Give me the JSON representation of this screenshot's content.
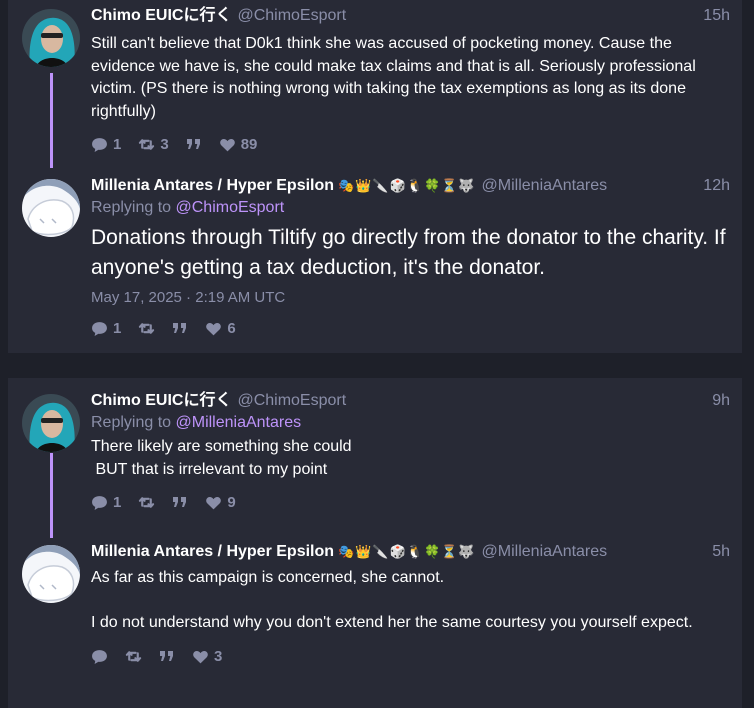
{
  "colors": {
    "background": "#1e2029",
    "card": "#282a36",
    "accent": "#bd93f9",
    "muted": "#8a8ea8",
    "text": "#ffffff"
  },
  "icons": {
    "reply": "speech-bubble-icon",
    "retweet": "retweet-icon",
    "quote": "quote-icon",
    "like": "heart-icon"
  },
  "thread1": {
    "tweet1": {
      "name": "Chimo EUICに行く",
      "handle": "@ChimoEsport",
      "time": "15h",
      "text": "Still can't believe that D0k1 think she was accused of pocketing money. Cause the evidence we have is, she could make tax claims and that is all.  Seriously professional victim. (PS there is nothing wrong with taking the tax exemptions as long as its done rightfully)",
      "replies": "1",
      "retweets": "3",
      "quotes": "",
      "likes": "89"
    },
    "tweet2": {
      "name": "Millenia Antares / Hyper Epsilon",
      "emojis": "🎭👑🔪🎲🐧🍀⏳🐺",
      "handle": "@MilleniaAntares",
      "time": "12h",
      "replying_prefix": "Replying to",
      "replying_to": "@ChimoEsport",
      "text": "Donations through Tiltify go directly from the donator to the charity. If anyone's getting a tax deduction, it's the donator.",
      "date": "May 17, 2025 · 2:19 AM UTC",
      "replies": "1",
      "retweets": "",
      "quotes": "",
      "likes": "6"
    }
  },
  "thread2": {
    "tweet1": {
      "name": "Chimo EUICに行く",
      "handle": "@ChimoEsport",
      "time": "9h",
      "replying_prefix": "Replying to",
      "replying_to": "@MilleniaAntares",
      "text_line1": "There likely are something she could",
      "text_line2": " BUT that is irrelevant to my point",
      "replies": "1",
      "retweets": "",
      "quotes": "",
      "likes": "9"
    },
    "tweet2": {
      "name": "Millenia Antares / Hyper Epsilon",
      "emojis": "🎭👑🔪🎲🐧🍀⏳🐺",
      "handle": "@MilleniaAntares",
      "time": "5h",
      "text_p1": "As far as this campaign is concerned, she cannot.",
      "text_p2": "I do not understand why you don't extend her the same courtesy you yourself expect.",
      "replies": "",
      "retweets": "",
      "quotes": "",
      "likes": "3"
    }
  }
}
